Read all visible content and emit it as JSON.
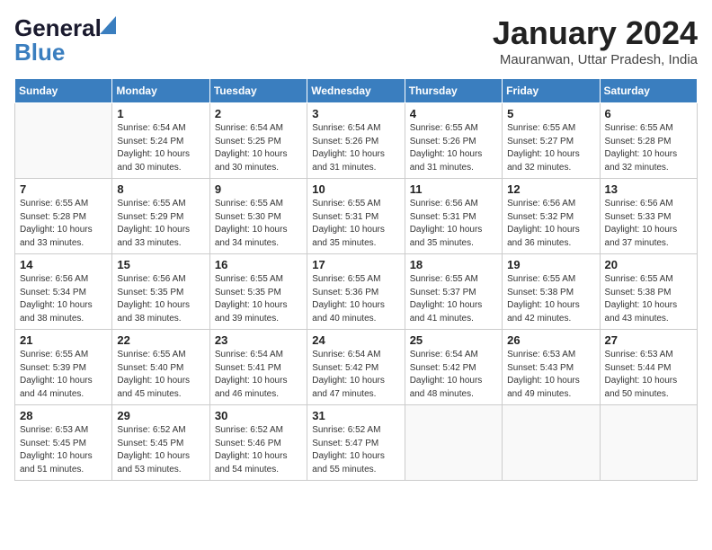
{
  "header": {
    "logo_general": "General",
    "logo_blue": "Blue",
    "month": "January 2024",
    "location": "Mauranwan, Uttar Pradesh, India"
  },
  "weekdays": [
    "Sunday",
    "Monday",
    "Tuesday",
    "Wednesday",
    "Thursday",
    "Friday",
    "Saturday"
  ],
  "weeks": [
    [
      {
        "day": "",
        "info": ""
      },
      {
        "day": "1",
        "info": "Sunrise: 6:54 AM\nSunset: 5:24 PM\nDaylight: 10 hours\nand 30 minutes."
      },
      {
        "day": "2",
        "info": "Sunrise: 6:54 AM\nSunset: 5:25 PM\nDaylight: 10 hours\nand 30 minutes."
      },
      {
        "day": "3",
        "info": "Sunrise: 6:54 AM\nSunset: 5:26 PM\nDaylight: 10 hours\nand 31 minutes."
      },
      {
        "day": "4",
        "info": "Sunrise: 6:55 AM\nSunset: 5:26 PM\nDaylight: 10 hours\nand 31 minutes."
      },
      {
        "day": "5",
        "info": "Sunrise: 6:55 AM\nSunset: 5:27 PM\nDaylight: 10 hours\nand 32 minutes."
      },
      {
        "day": "6",
        "info": "Sunrise: 6:55 AM\nSunset: 5:28 PM\nDaylight: 10 hours\nand 32 minutes."
      }
    ],
    [
      {
        "day": "7",
        "info": "Sunrise: 6:55 AM\nSunset: 5:28 PM\nDaylight: 10 hours\nand 33 minutes."
      },
      {
        "day": "8",
        "info": "Sunrise: 6:55 AM\nSunset: 5:29 PM\nDaylight: 10 hours\nand 33 minutes."
      },
      {
        "day": "9",
        "info": "Sunrise: 6:55 AM\nSunset: 5:30 PM\nDaylight: 10 hours\nand 34 minutes."
      },
      {
        "day": "10",
        "info": "Sunrise: 6:55 AM\nSunset: 5:31 PM\nDaylight: 10 hours\nand 35 minutes."
      },
      {
        "day": "11",
        "info": "Sunrise: 6:56 AM\nSunset: 5:31 PM\nDaylight: 10 hours\nand 35 minutes."
      },
      {
        "day": "12",
        "info": "Sunrise: 6:56 AM\nSunset: 5:32 PM\nDaylight: 10 hours\nand 36 minutes."
      },
      {
        "day": "13",
        "info": "Sunrise: 6:56 AM\nSunset: 5:33 PM\nDaylight: 10 hours\nand 37 minutes."
      }
    ],
    [
      {
        "day": "14",
        "info": "Sunrise: 6:56 AM\nSunset: 5:34 PM\nDaylight: 10 hours\nand 38 minutes."
      },
      {
        "day": "15",
        "info": "Sunrise: 6:56 AM\nSunset: 5:35 PM\nDaylight: 10 hours\nand 38 minutes."
      },
      {
        "day": "16",
        "info": "Sunrise: 6:55 AM\nSunset: 5:35 PM\nDaylight: 10 hours\nand 39 minutes."
      },
      {
        "day": "17",
        "info": "Sunrise: 6:55 AM\nSunset: 5:36 PM\nDaylight: 10 hours\nand 40 minutes."
      },
      {
        "day": "18",
        "info": "Sunrise: 6:55 AM\nSunset: 5:37 PM\nDaylight: 10 hours\nand 41 minutes."
      },
      {
        "day": "19",
        "info": "Sunrise: 6:55 AM\nSunset: 5:38 PM\nDaylight: 10 hours\nand 42 minutes."
      },
      {
        "day": "20",
        "info": "Sunrise: 6:55 AM\nSunset: 5:38 PM\nDaylight: 10 hours\nand 43 minutes."
      }
    ],
    [
      {
        "day": "21",
        "info": "Sunrise: 6:55 AM\nSunset: 5:39 PM\nDaylight: 10 hours\nand 44 minutes."
      },
      {
        "day": "22",
        "info": "Sunrise: 6:55 AM\nSunset: 5:40 PM\nDaylight: 10 hours\nand 45 minutes."
      },
      {
        "day": "23",
        "info": "Sunrise: 6:54 AM\nSunset: 5:41 PM\nDaylight: 10 hours\nand 46 minutes."
      },
      {
        "day": "24",
        "info": "Sunrise: 6:54 AM\nSunset: 5:42 PM\nDaylight: 10 hours\nand 47 minutes."
      },
      {
        "day": "25",
        "info": "Sunrise: 6:54 AM\nSunset: 5:42 PM\nDaylight: 10 hours\nand 48 minutes."
      },
      {
        "day": "26",
        "info": "Sunrise: 6:53 AM\nSunset: 5:43 PM\nDaylight: 10 hours\nand 49 minutes."
      },
      {
        "day": "27",
        "info": "Sunrise: 6:53 AM\nSunset: 5:44 PM\nDaylight: 10 hours\nand 50 minutes."
      }
    ],
    [
      {
        "day": "28",
        "info": "Sunrise: 6:53 AM\nSunset: 5:45 PM\nDaylight: 10 hours\nand 51 minutes."
      },
      {
        "day": "29",
        "info": "Sunrise: 6:52 AM\nSunset: 5:45 PM\nDaylight: 10 hours\nand 53 minutes."
      },
      {
        "day": "30",
        "info": "Sunrise: 6:52 AM\nSunset: 5:46 PM\nDaylight: 10 hours\nand 54 minutes."
      },
      {
        "day": "31",
        "info": "Sunrise: 6:52 AM\nSunset: 5:47 PM\nDaylight: 10 hours\nand 55 minutes."
      },
      {
        "day": "",
        "info": ""
      },
      {
        "day": "",
        "info": ""
      },
      {
        "day": "",
        "info": ""
      }
    ]
  ]
}
